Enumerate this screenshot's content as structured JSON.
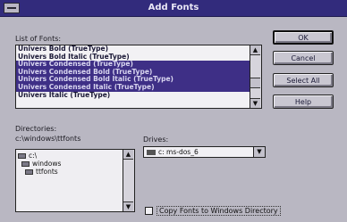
{
  "window": {
    "title": "Add Fonts"
  },
  "list_label": "List of Fonts:",
  "fonts": [
    {
      "name": "Univers Bold (TrueType)",
      "selected": false
    },
    {
      "name": "Univers Bold Italic (TrueType)",
      "selected": false
    },
    {
      "name": "Univers Condensed (TrueType)",
      "selected": true
    },
    {
      "name": "Univers Condensed Bold (TrueType)",
      "selected": true
    },
    {
      "name": "Univers Condensed Bold Italic (TrueType)",
      "selected": true
    },
    {
      "name": "Univers Condensed Italic (TrueType)",
      "selected": true
    },
    {
      "name": "Univers Italic (TrueType)",
      "selected": false
    }
  ],
  "buttons": {
    "ok": "OK",
    "cancel": "Cancel",
    "select_all": "Select All",
    "help": "Help"
  },
  "directories": {
    "label": "Directories:",
    "path": "c:\\windows\\ttfonts",
    "items": [
      "c:\\",
      "windows",
      "ttfonts"
    ]
  },
  "drives": {
    "label": "Drives:",
    "value": "c: ms-dos_6"
  },
  "copy_option": {
    "label": "Copy Fonts to Windows Directory",
    "checked": false
  },
  "scroll_icons": {
    "up": "▲",
    "down": "▼"
  },
  "colors": {
    "titlebar": "#322b7c",
    "selection": "#3e2f86",
    "face": "#b9b7c2"
  }
}
